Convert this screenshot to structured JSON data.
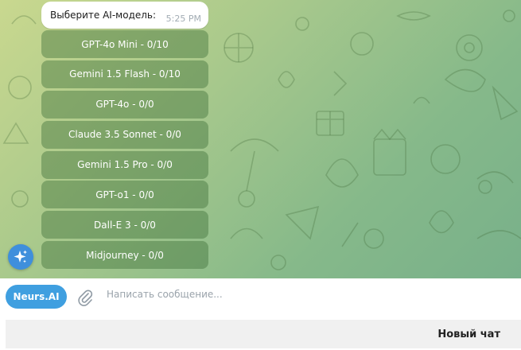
{
  "chat": {
    "message": {
      "text": "Выберите AI-модель:",
      "time": "5:25 PM"
    },
    "inline_keyboard": [
      {
        "label": "GPT-4o Mini - 0/10"
      },
      {
        "label": "Gemini 1.5 Flash - 0/10"
      },
      {
        "label": "GPT-4o - 0/0"
      },
      {
        "label": "Claude 3.5 Sonnet - 0/0"
      },
      {
        "label": "Gemini 1.5 Pro - 0/0"
      },
      {
        "label": "GPT-o1 - 0/0"
      },
      {
        "label": "Dall-E 3 - 0/0"
      },
      {
        "label": "Midjourney - 0/0"
      }
    ],
    "fab_icon": "sparkle-icon"
  },
  "composer": {
    "menu_button": "Neurs.AI",
    "attach_icon": "paperclip-icon",
    "placeholder": "Написать сообщение..."
  },
  "reply_keyboard": {
    "button": "Новый чат"
  },
  "colors": {
    "accent": "#3f9fe0",
    "fab": "#3f8fdc",
    "wallpaper_start": "#c9d88f",
    "wallpaper_end": "#78b08a",
    "keyboard_button": "#3c6e37"
  }
}
